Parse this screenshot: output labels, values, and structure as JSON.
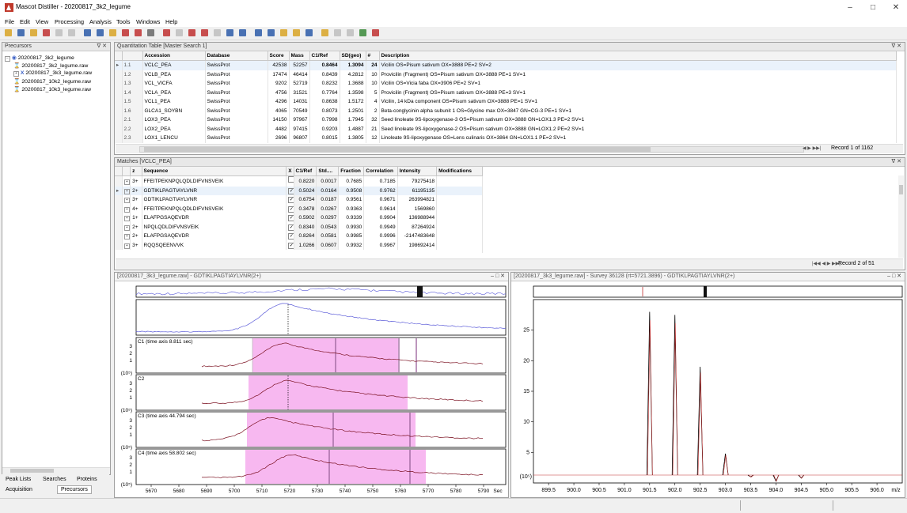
{
  "app": {
    "title": "Mascot Distiller - 20200817_3k2_legume"
  },
  "menu": [
    "File",
    "Edit",
    "View",
    "Processing",
    "Analysis",
    "Tools",
    "Windows",
    "Help"
  ],
  "precursors": {
    "title": "Precursors",
    "root": "20200817_3k2_legume",
    "files": [
      "20200817_3k2_legume.raw",
      "20200817_3k3_legume.raw",
      "20200817_10k2_legume.raw",
      "20200817_10k3_legume.raw"
    ]
  },
  "left_tabs": {
    "row1": [
      "Peak Lists",
      "Searches",
      "Proteins"
    ],
    "row2": [
      "Acquisition",
      "Precursors"
    ]
  },
  "quant": {
    "title": "Quantitation Table [Master Search 1]",
    "columns": [
      "Accession",
      "Database",
      "Score",
      "Mass",
      "C1/Ref",
      "SD(geo)",
      "#",
      "Description"
    ],
    "rows": [
      {
        "id": "1.1",
        "acc": "VCLC_PEA",
        "db": "SwissProt",
        "score": "42538",
        "mass": "52257",
        "ratio": "0.8464",
        "sd": "1.3094",
        "n": "24",
        "desc": "Vicilin OS=Pisum sativum OX=3888 PE=2 SV=2"
      },
      {
        "id": "1.2",
        "acc": "VCLB_PEA",
        "db": "SwissProt",
        "score": "17474",
        "mass": "46414",
        "ratio": "0.8439",
        "sd": "4.2812",
        "n": "10",
        "desc": "Provicilin (Fragment) OS=Pisum sativum OX=3888 PE=1 SV=1"
      },
      {
        "id": "1.3",
        "acc": "VCL_VICFA",
        "db": "SwissProt",
        "score": "9202",
        "mass": "52719",
        "ratio": "0.8232",
        "sd": "1.3688",
        "n": "10",
        "desc": "Vicilin OS=Vicia faba OX=3906 PE=2 SV=1"
      },
      {
        "id": "1.4",
        "acc": "VCLA_PEA",
        "db": "SwissProt",
        "score": "4756",
        "mass": "31521",
        "ratio": "0.7764",
        "sd": "1.3598",
        "n": "5",
        "desc": "Provicilin (Fragment) OS=Pisum sativum OX=3888 PE=3 SV=1"
      },
      {
        "id": "1.5",
        "acc": "VCL1_PEA",
        "db": "SwissProt",
        "score": "4296",
        "mass": "14031",
        "ratio": "0.8638",
        "sd": "1.5172",
        "n": "4",
        "desc": "Vicilin, 14 kDa component OS=Pisum sativum OX=3888 PE=1 SV=1"
      },
      {
        "id": "1.6",
        "acc": "GLCA1_SOYBN",
        "db": "SwissProt",
        "score": "4065",
        "mass": "70549",
        "ratio": "0.8073",
        "sd": "1.2501",
        "n": "2",
        "desc": "Beta-conglycinin alpha subunit 1 OS=Glycine max OX=3847 GN=CG-3 PE=1 SV=1"
      },
      {
        "id": "2.1",
        "acc": "LOX3_PEA",
        "db": "SwissProt",
        "score": "14150",
        "mass": "97967",
        "ratio": "0.7998",
        "sd": "1.7945",
        "n": "32",
        "desc": "Seed linoleate 9S-lipoxygenase-3 OS=Pisum sativum OX=3888 GN=LOX1.3 PE=2 SV=1"
      },
      {
        "id": "2.2",
        "acc": "LOX2_PEA",
        "db": "SwissProt",
        "score": "4482",
        "mass": "97415",
        "ratio": "0.9203",
        "sd": "1.4887",
        "n": "21",
        "desc": "Seed linoleate 9S-lipoxygenase-2 OS=Pisum sativum OX=3888 GN=LOX1.2 PE=2 SV=1"
      },
      {
        "id": "2.3",
        "acc": "LOX1_LENCU",
        "db": "SwissProt",
        "score": "2696",
        "mass": "96807",
        "ratio": "0.8015",
        "sd": "1.3805",
        "n": "12",
        "desc": "Linoleate 9S-lipoxygenase OS=Lens culinaris OX=3864 GN=LOX1.1 PE=2 SV=1"
      }
    ],
    "record": "Record 1 of 1162"
  },
  "matches": {
    "title": "Matches [VCLC_PEA]",
    "columns": [
      "z",
      "Sequence",
      "X",
      "C1/Ref",
      "Std....",
      "Fraction",
      "Correlation",
      "Intensity",
      "Modifications"
    ],
    "rows": [
      {
        "z": "3+",
        "seq": "FFEITPEKNPQLQDLDIFVNSVEIK",
        "x": false,
        "ratio": "0.8220",
        "std": "0.0017",
        "frac": "0.7685",
        "corr": "0.7185",
        "int": "79275418"
      },
      {
        "z": "2+",
        "seq": "GDTIKLPAGTIAYLVNR",
        "x": true,
        "ratio": "0.5024",
        "std": "0.0164",
        "frac": "0.9508",
        "corr": "0.9762",
        "int": "61195135"
      },
      {
        "z": "3+",
        "seq": "GDTIKLPAGTIAYLVNR",
        "x": true,
        "ratio": "0.6754",
        "std": "0.0187",
        "frac": "0.9561",
        "corr": "0.9671",
        "int": "263994821"
      },
      {
        "z": "4+",
        "seq": "FFEITPEKNPQLQDLDIFVNSVEIK",
        "x": true,
        "ratio": "0.3478",
        "std": "0.0267",
        "frac": "0.9363",
        "corr": "0.9614",
        "int": "1569860"
      },
      {
        "z": "1+",
        "seq": "ELAFPGSAQEVDR",
        "x": true,
        "ratio": "0.5902",
        "std": "0.0297",
        "frac": "0.9339",
        "corr": "0.9904",
        "int": "136988944"
      },
      {
        "z": "2+",
        "seq": "NPQLQDLDIFVNSVEIK",
        "x": true,
        "ratio": "0.8340",
        "std": "0.0543",
        "frac": "0.9930",
        "corr": "0.9949",
        "int": "87264924"
      },
      {
        "z": "2+",
        "seq": "ELAFPGSAQEVDR",
        "x": true,
        "ratio": "0.8264",
        "std": "0.0581",
        "frac": "0.9985",
        "corr": "0.9996",
        "int": "-2147483648"
      },
      {
        "z": "3+",
        "seq": "RQQSQEENVVK",
        "x": true,
        "ratio": "1.0266",
        "std": "0.0607",
        "frac": "0.9932",
        "corr": "0.9967",
        "int": "198692414"
      }
    ],
    "record": "Record 2 of 51"
  },
  "xic": {
    "title": "[20200817_3k3_legume.raw] - GDTIKLPAGTIAYLVNR(2+)",
    "ylabel": "(10⁵)",
    "x_ticks": [
      "5670",
      "5680",
      "5690",
      "5700",
      "5710",
      "5720",
      "5730",
      "5740",
      "5750",
      "5760",
      "5770",
      "5780",
      "5790"
    ],
    "x_unit": "Sec",
    "y_ticks": [
      "3",
      "2",
      "1"
    ],
    "traces": [
      "C1 (time axis 8.811 sec)",
      "C2",
      "C3 (time axis 44.794 sec)",
      "C4 (time axis 58.802 sec)"
    ],
    "highlight_colors": {
      "band": "#f7b8f0",
      "trace": "#7b1020"
    }
  },
  "spectrum": {
    "title": "[20200817_3k3_legume.raw] - Survey 36128 (rt=5721.3896) - GDTIKLPAGTIAYLVNR(2+)",
    "x_ticks": [
      "899.5",
      "900.0",
      "900.5",
      "901.0",
      "901.5",
      "902.0",
      "902.5",
      "903.0",
      "903.5",
      "904.0",
      "904.5",
      "905.0",
      "905.5",
      "906.0"
    ],
    "x_unit": "m/z",
    "y_ticks": [
      "25",
      "20",
      "15",
      "10",
      "5"
    ],
    "ylabel": "(10⁵)"
  },
  "chart_data": {
    "type": "bar",
    "title": "",
    "xlabel": "m/z",
    "ylabel": "(10⁵)",
    "x": [
      901.5,
      902.0,
      902.5,
      903.0,
      903.5,
      904.0,
      904.5
    ],
    "series": [
      {
        "values": [
          28,
          27.5,
          19,
          4.8,
          1.0,
          0.3,
          0.8
        ]
      }
    ],
    "xlim": [
      899.2,
      906.5
    ],
    "ylim": [
      0,
      30
    ]
  }
}
